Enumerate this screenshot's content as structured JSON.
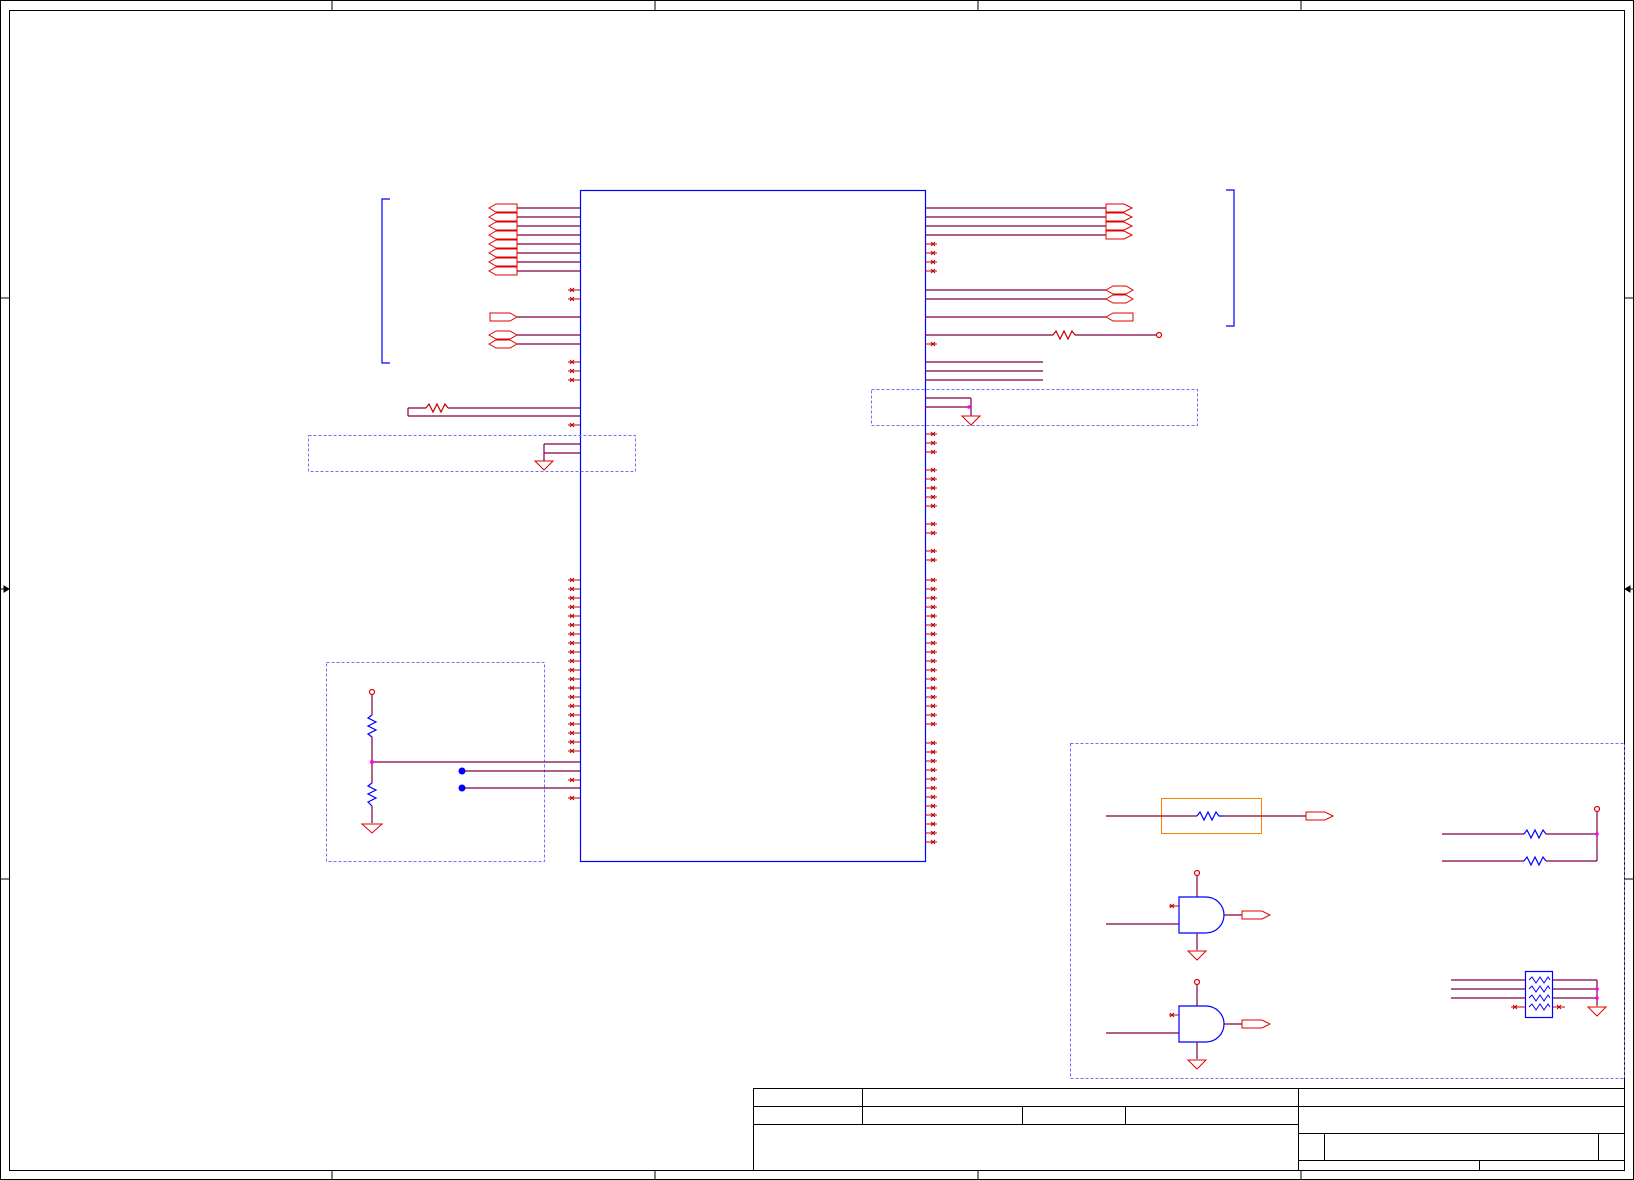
{
  "title_block": {
    "visible_text": []
  },
  "colors": {
    "frame": "#000000",
    "component_body": "#0000ff",
    "wire": "#800040",
    "pin": "#c00000",
    "net_port": "#e00000",
    "junction": "#ff00ff",
    "group_box": "#7070ff",
    "highlight_box": "#ff8000",
    "net_dot": "#0000ff"
  },
  "components": {
    "main_ic": {
      "icon": "ic-body"
    },
    "left_bus_bracket": {
      "icon": "bracket"
    },
    "right_bus_bracket": {
      "icon": "bracket"
    },
    "and_gate_upper": {
      "icon": "and-gate"
    },
    "and_gate_lower": {
      "icon": "and-gate"
    },
    "resistor_network": {
      "icon": "resistor-array"
    }
  }
}
